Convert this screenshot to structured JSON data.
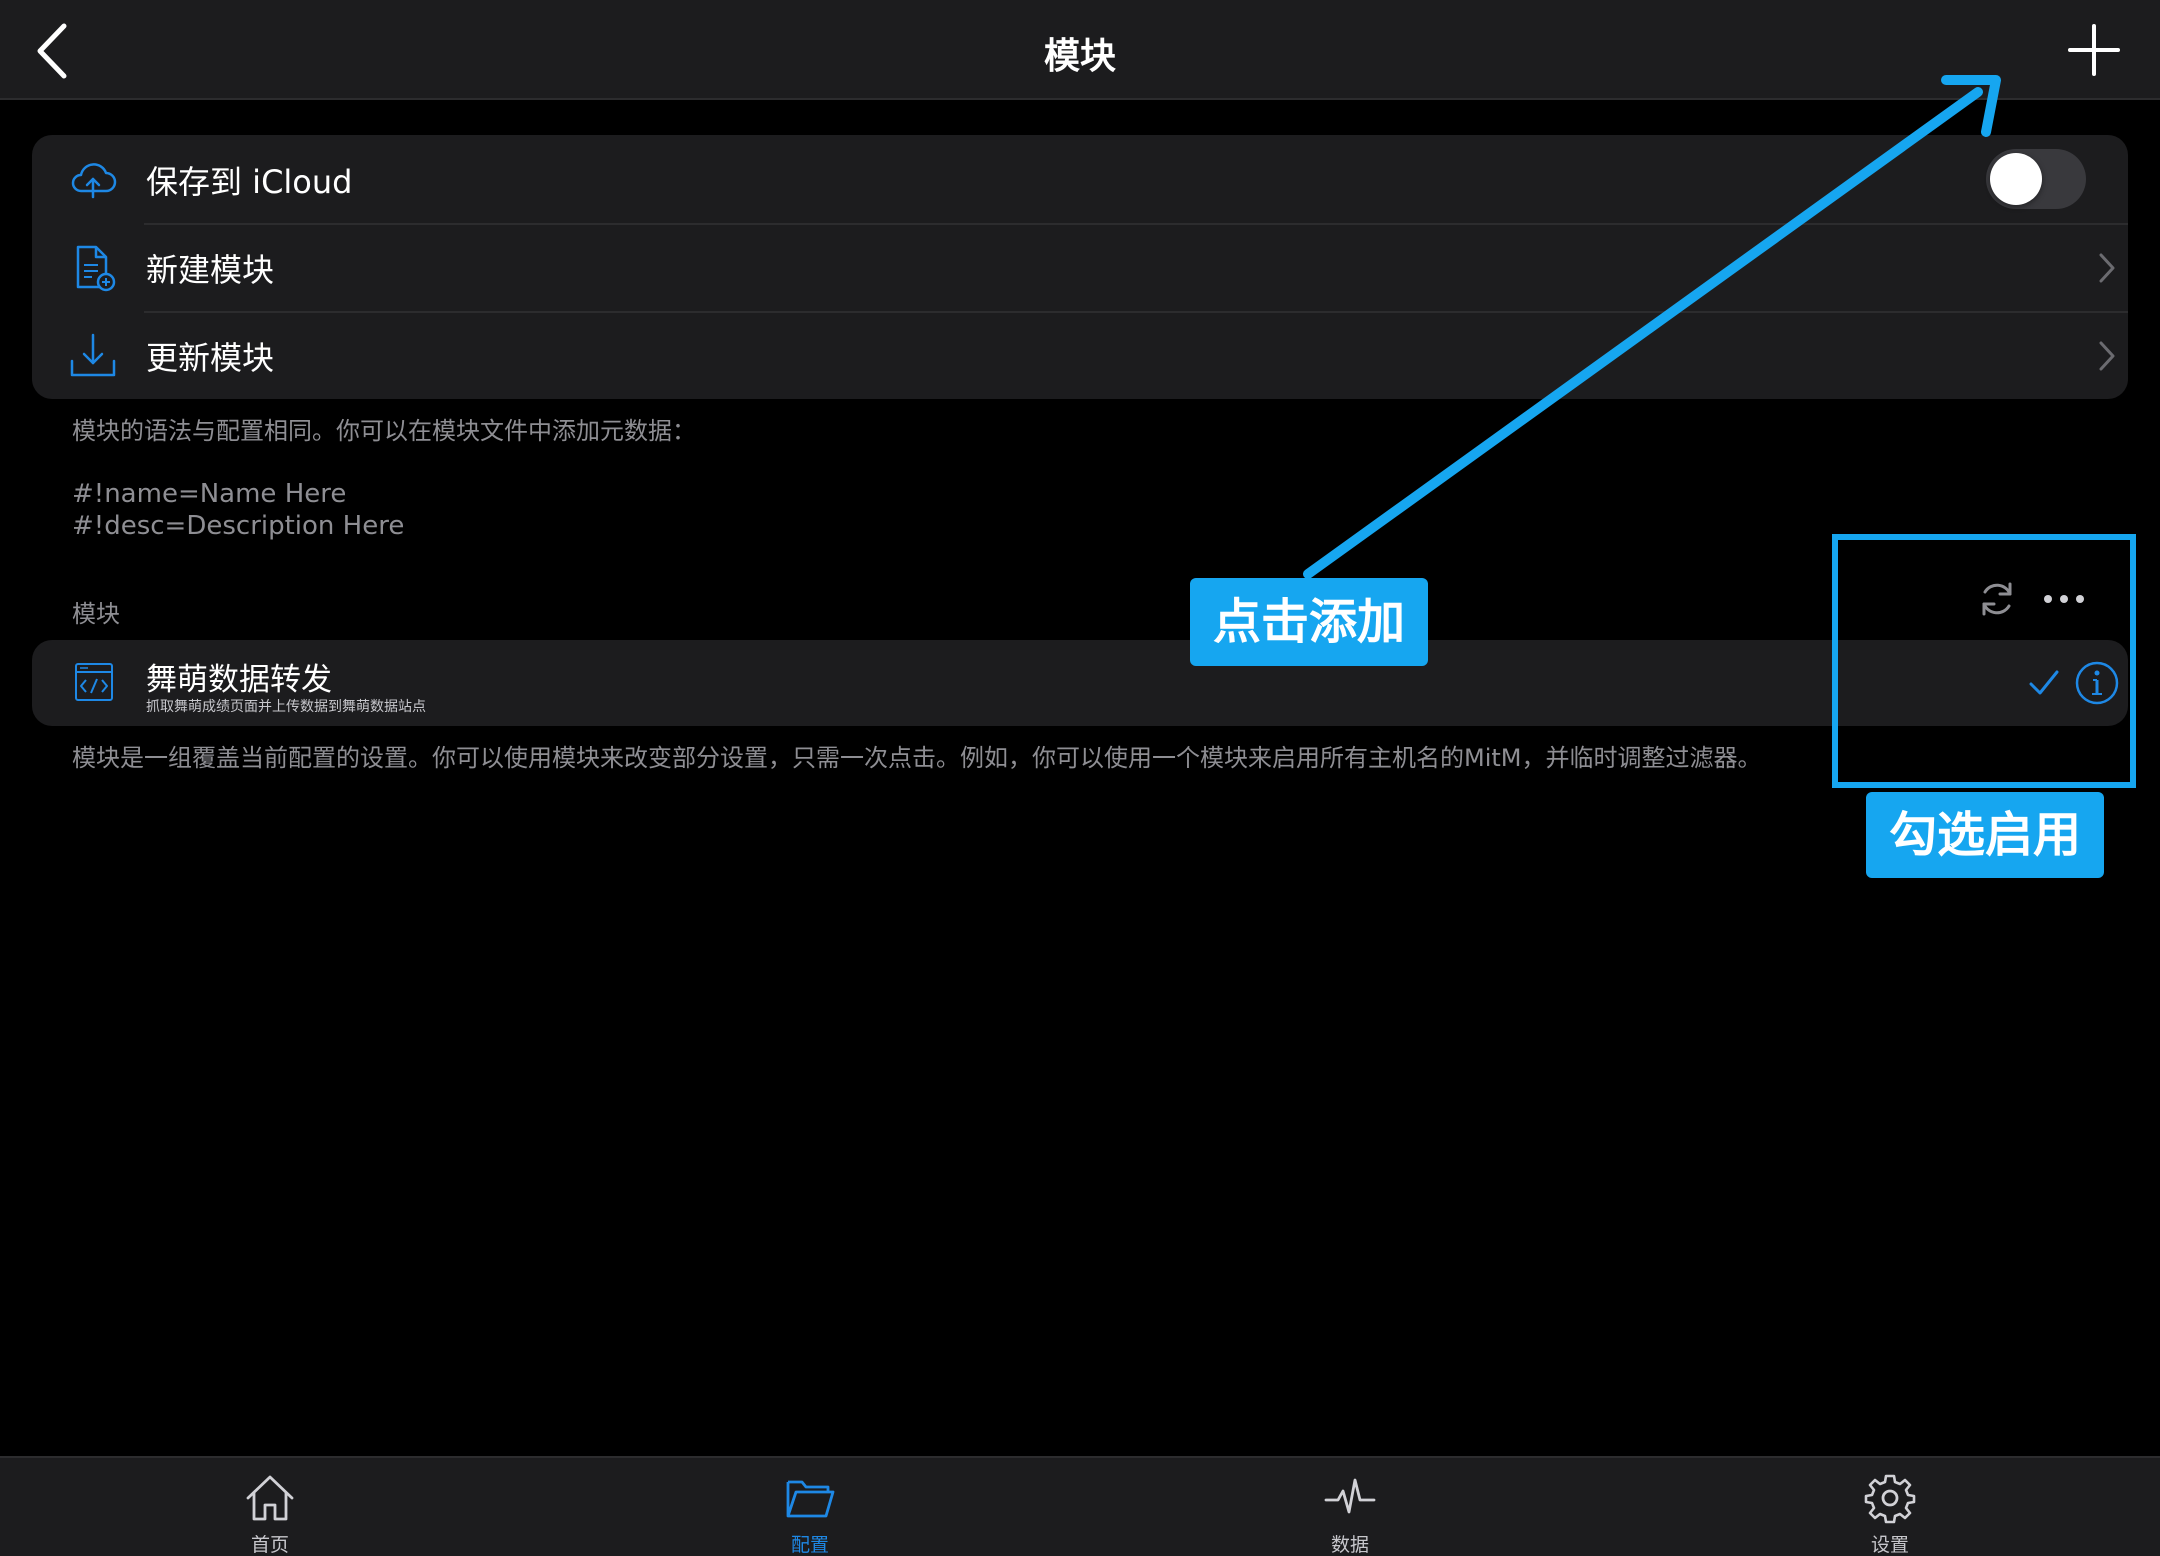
{
  "navbar": {
    "title": "模块",
    "back_icon": "chevron-left-icon",
    "add_icon": "plus-icon"
  },
  "settings": {
    "rows": [
      {
        "label": "保存到 iCloud",
        "icon": "icloud-upload-icon",
        "control": "toggle",
        "toggle_on": false
      },
      {
        "label": "新建模块",
        "icon": "new-document-icon",
        "control": "chevron"
      },
      {
        "label": "更新模块",
        "icon": "download-icon",
        "control": "chevron"
      }
    ],
    "footer": "模块的语法与配置相同。你可以在模块文件中添加元数据：",
    "code_line_1": "#!name=Name Here",
    "code_line_2": "#!desc=Description Here"
  },
  "modules": {
    "header": "模块",
    "items": [
      {
        "name": "舞萌数据转发",
        "description": "抓取舞萌成绩页面并上传数据到舞萌数据站点",
        "icon": "code-file-icon",
        "enabled": true
      }
    ],
    "footer": "模块是一组覆盖当前配置的设置。你可以使用模块来改变部分设置，只需一次点击。例如，你可以使用一个模块来启用所有主机名的MitM，并临时调整过滤器。"
  },
  "tabbar": {
    "active": "config",
    "tabs": [
      {
        "id": "home",
        "label": "首页",
        "icon": "home-icon"
      },
      {
        "id": "config",
        "label": "配置",
        "icon": "folder-icon"
      },
      {
        "id": "data",
        "label": "数据",
        "icon": "activity-icon"
      },
      {
        "id": "settings",
        "label": "设置",
        "icon": "gear-icon"
      }
    ]
  },
  "annotations": {
    "add_callout": "点击添加",
    "enable_callout": "勾选启用"
  },
  "colors": {
    "accent": "#1e88e5",
    "annotation": "#16a6f0",
    "background": "#000000",
    "card": "#1c1c1e",
    "secondary_text": "#8e8e93"
  }
}
